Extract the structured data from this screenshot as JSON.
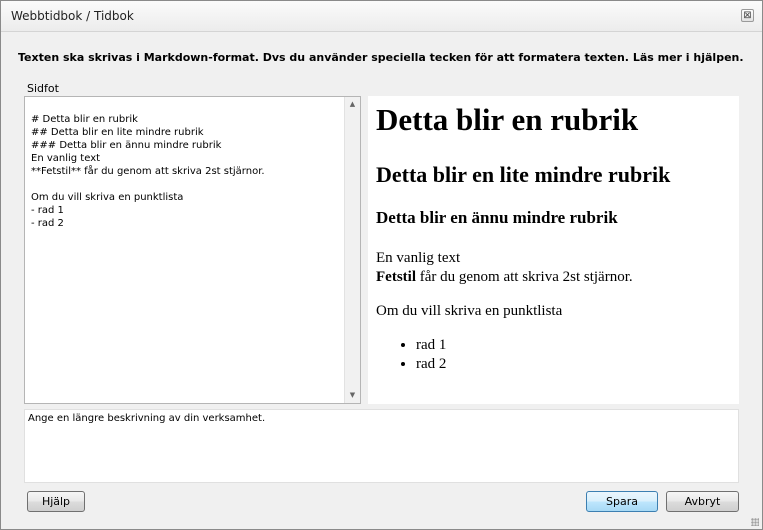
{
  "window": {
    "title": "Webbtidbok / Tidbok",
    "close_glyph": "⊠"
  },
  "instructions": "Texten ska skrivas i Markdown-format. Dvs du använder speciella tecken för att formatera texten. Läs mer i hjälpen.",
  "footer_label": "Sidfot",
  "editor": {
    "content": "# Detta blir en rubrik\n## Detta blir en lite mindre rubrik\n### Detta blir en ännu mindre rubrik\nEn vanlig text\n**Fetstil** får du genom att skriva 2st stjärnor.\n\nOm du vill skriva en punktlista\n- rad 1\n- rad 2"
  },
  "preview": {
    "h1": "Detta blir en rubrik",
    "h2": "Detta blir en lite mindre rubrik",
    "h3": "Detta blir en ännu mindre rubrik",
    "plain_text": "En vanlig text",
    "bold_text": "Fetstil",
    "bold_suffix": " får du genom att skriva 2st stjärnor.",
    "list_intro": "Om du vill skriva en punktlista",
    "list_items": [
      "rad 1",
      "rad 2"
    ]
  },
  "description": {
    "placeholder": "Ange en längre beskrivning av din verksamhet."
  },
  "buttons": {
    "help": "Hjälp",
    "save": "Spara",
    "cancel": "Avbryt"
  },
  "icons": {
    "scroll_up": "▲",
    "scroll_down": "▼"
  }
}
